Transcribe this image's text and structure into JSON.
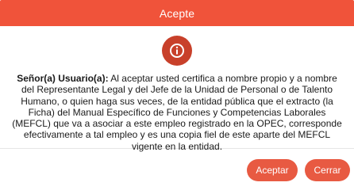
{
  "dialog": {
    "title": "Acepte",
    "icon": "info-icon",
    "message_bold": "Señor(a) Usuario(a):",
    "message_body": " Al aceptar usted certifica a nombre propio y a nombre del Representante Legal y del Jefe de la Unidad de Personal o de Talento Humano, o quien haga sus veces, de la entidad pública que el extracto (la Ficha) del Manual Específico de Funciones y Competencias Laborales (MEFCL) que va a asociar a este empleo registrado en la OPEC, corresponde efectivamente a tal empleo y es una copia fiel de este aparte del MEFCL vigente en la entidad.",
    "accept_label": "Aceptar",
    "close_label": "Cerrar"
  },
  "colors": {
    "header": "#f0533a",
    "icon_circle": "#c8402a",
    "button": "#e85a42"
  }
}
